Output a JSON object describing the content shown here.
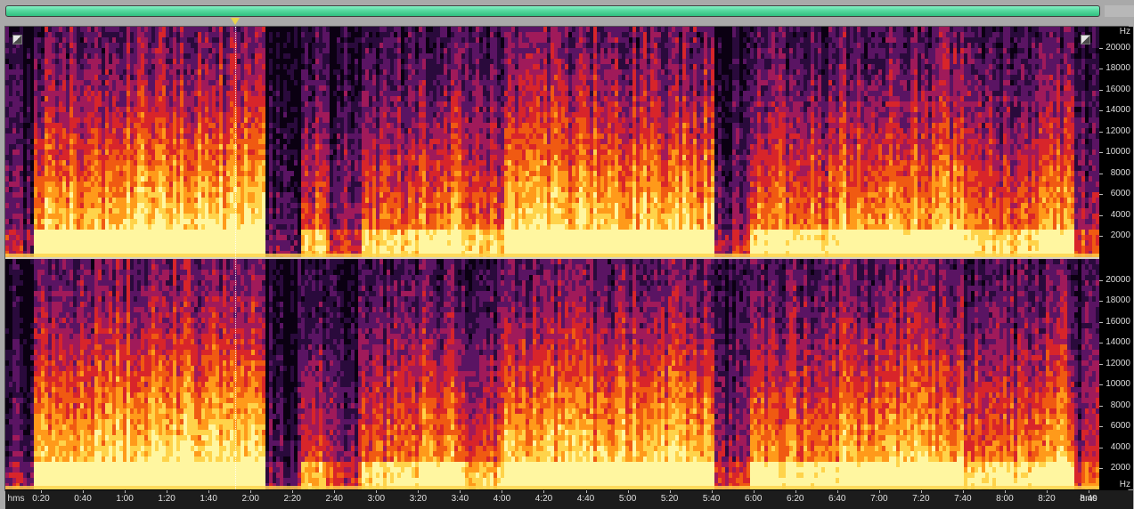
{
  "overview": {
    "bar_color": "#55d89e",
    "playhead_color": "#e8d34a"
  },
  "spectrogram": {
    "colormap": [
      "#0b0012",
      "#2a0a3c",
      "#5a1463",
      "#a01a5a",
      "#d8252a",
      "#f05a12",
      "#ff9a1a",
      "#ffd34a",
      "#fff6a0"
    ],
    "channels": 2,
    "max_freq_hz": 22000,
    "duration_sec": 540,
    "cursor_time": "1:53"
  },
  "freq_axis": {
    "unit_label": "Hz",
    "labels": [
      "20000",
      "18000",
      "16000",
      "14000",
      "12000",
      "10000",
      "8000",
      "6000",
      "4000",
      "2000"
    ],
    "values": [
      20000,
      18000,
      16000,
      14000,
      12000,
      10000,
      8000,
      6000,
      4000,
      2000
    ]
  },
  "time_axis": {
    "unit_label": "hms",
    "labels": [
      "0:20",
      "0:40",
      "1:00",
      "1:20",
      "1:40",
      "2:00",
      "2:20",
      "2:40",
      "3:00",
      "3:20",
      "3:40",
      "4:00",
      "4:20",
      "4:40",
      "5:00",
      "5:20",
      "5:40",
      "6:00",
      "6:20",
      "6:40",
      "7:00",
      "7:20",
      "7:40",
      "8:00",
      "8:20",
      "8:40"
    ],
    "seconds": [
      20,
      40,
      60,
      80,
      100,
      120,
      140,
      160,
      180,
      200,
      220,
      240,
      260,
      280,
      300,
      320,
      340,
      360,
      380,
      400,
      420,
      440,
      460,
      480,
      500,
      520
    ]
  }
}
